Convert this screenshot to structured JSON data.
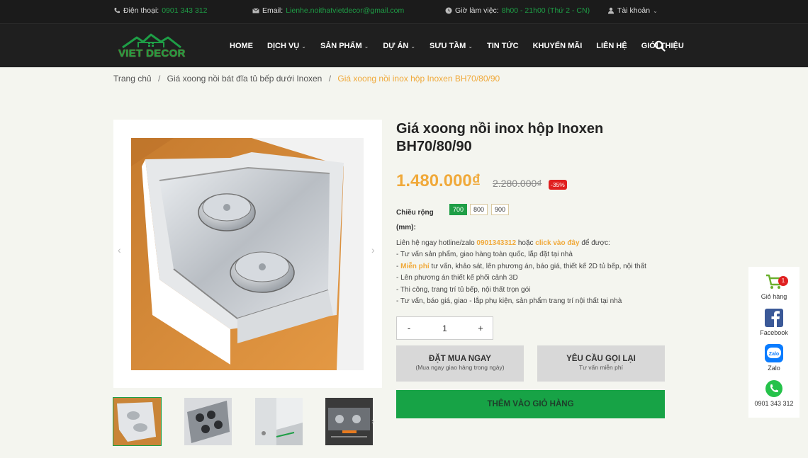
{
  "topbar": {
    "phone_label": "Điện thoại:",
    "phone_value": "0901 343 312",
    "email_label": "Email:",
    "email_value": "Lienhe.noithatvietdecor@gmail.com",
    "hours_label": "Giờ làm việc:",
    "hours_value": "8h00 - 21h00 (Thứ 2 - CN)",
    "account_label": "Tài khoản"
  },
  "brand": {
    "name": "VIET DECOR"
  },
  "nav": {
    "home": "HOME",
    "services": "DỊCH VỤ",
    "products": "SẢN PHẨM",
    "projects": "DỰ ÁN",
    "collection": "SƯU TẦM",
    "news": "TIN TỨC",
    "promo": "KHUYẾN MÃI",
    "contact": "LIÊN HỆ",
    "about": "GIỚI THIỆU"
  },
  "breadcrumb": {
    "home": "Trang chủ",
    "category": "Giá xoong nồi bát đĩa tủ bếp dưới Inoxen",
    "current": "Giá xoong nồi inox hộp Inoxen BH70/80/90"
  },
  "product": {
    "title": "Giá xoong nồi inox hộp Inoxen BH70/80/90",
    "price": "1.480.000₫",
    "old_price": "2.280.000₫",
    "discount": "-35%",
    "width_label": "Chiều rộng (mm):",
    "options": [
      "700",
      "800",
      "900"
    ],
    "selected_option": "700",
    "quantity": "1"
  },
  "description": {
    "intro_a": "Liên hệ ngay hotline/zalo ",
    "hotline": "0901343312",
    "intro_b": " hoặc ",
    "click_here": "click vào đây",
    "intro_c": " để được:",
    "line1": "- Tư vấn sản phẩm, giao hàng toàn quốc, lắp đặt tại nhà",
    "line2_dash": "- ",
    "line2_hl": "Miễn phí",
    "line2_rest": " tư vấn, khảo sát, lên phương án, báo giá, thiết kế 2D tủ bếp, nội thất",
    "line3": "- Lên phương án thiết kế phối cảnh 3D",
    "line4": "- Thi công, trang trí tủ bếp, nội thất trọn gói",
    "line5": "- Tư vấn, báo giá, giao - lắp phụ kiện, sản phẩm trang trí nội thất tại nhà"
  },
  "buttons": {
    "buy_now": "ĐẶT MUA NGAY",
    "buy_now_sub": "(Mua ngay giao hàng trong ngày)",
    "callback": "YÊU CẦU GỌI LẠI",
    "callback_sub": "Tư vấn miễn phí",
    "add_to_cart": "THÊM VÀO GIỎ HÀNG",
    "qty_minus": "-",
    "qty_plus": "+"
  },
  "floating": {
    "cart": "Giỏ hàng",
    "cart_count": "1",
    "facebook": "Facebook",
    "zalo": "Zalo",
    "phone": "0901 343 312"
  },
  "colors": {
    "green": "#1e9e46",
    "accent": "#f0a93a",
    "sale": "#e02020",
    "dark": "#1f1f1f"
  }
}
